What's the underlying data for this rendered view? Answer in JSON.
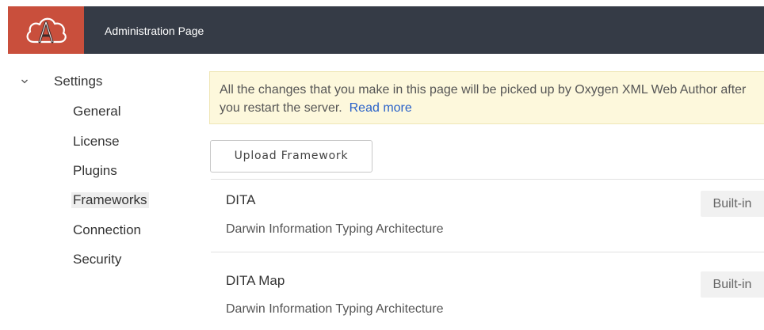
{
  "header": {
    "title": "Administration Page",
    "logo_letter": "A",
    "logo_bg": "#c94f3c",
    "bar_bg": "#353b46"
  },
  "sidebar": {
    "section_label": "Settings",
    "items": [
      {
        "label": "General"
      },
      {
        "label": "License"
      },
      {
        "label": "Plugins"
      },
      {
        "label": "Frameworks",
        "active": true
      },
      {
        "label": "Connection"
      },
      {
        "label": "Security"
      }
    ]
  },
  "notice": {
    "text": "All the changes that you make in this page will be picked up by Oxygen XML Web Author after you restart the server.",
    "link": "Read more"
  },
  "upload_button": "Upload Framework",
  "frameworks": [
    {
      "name": "DITA",
      "description": "Darwin Information Typing Architecture",
      "badge": "Built-in"
    },
    {
      "name": "DITA Map",
      "description": "Darwin Information Typing Architecture",
      "badge": "Built-in"
    }
  ]
}
